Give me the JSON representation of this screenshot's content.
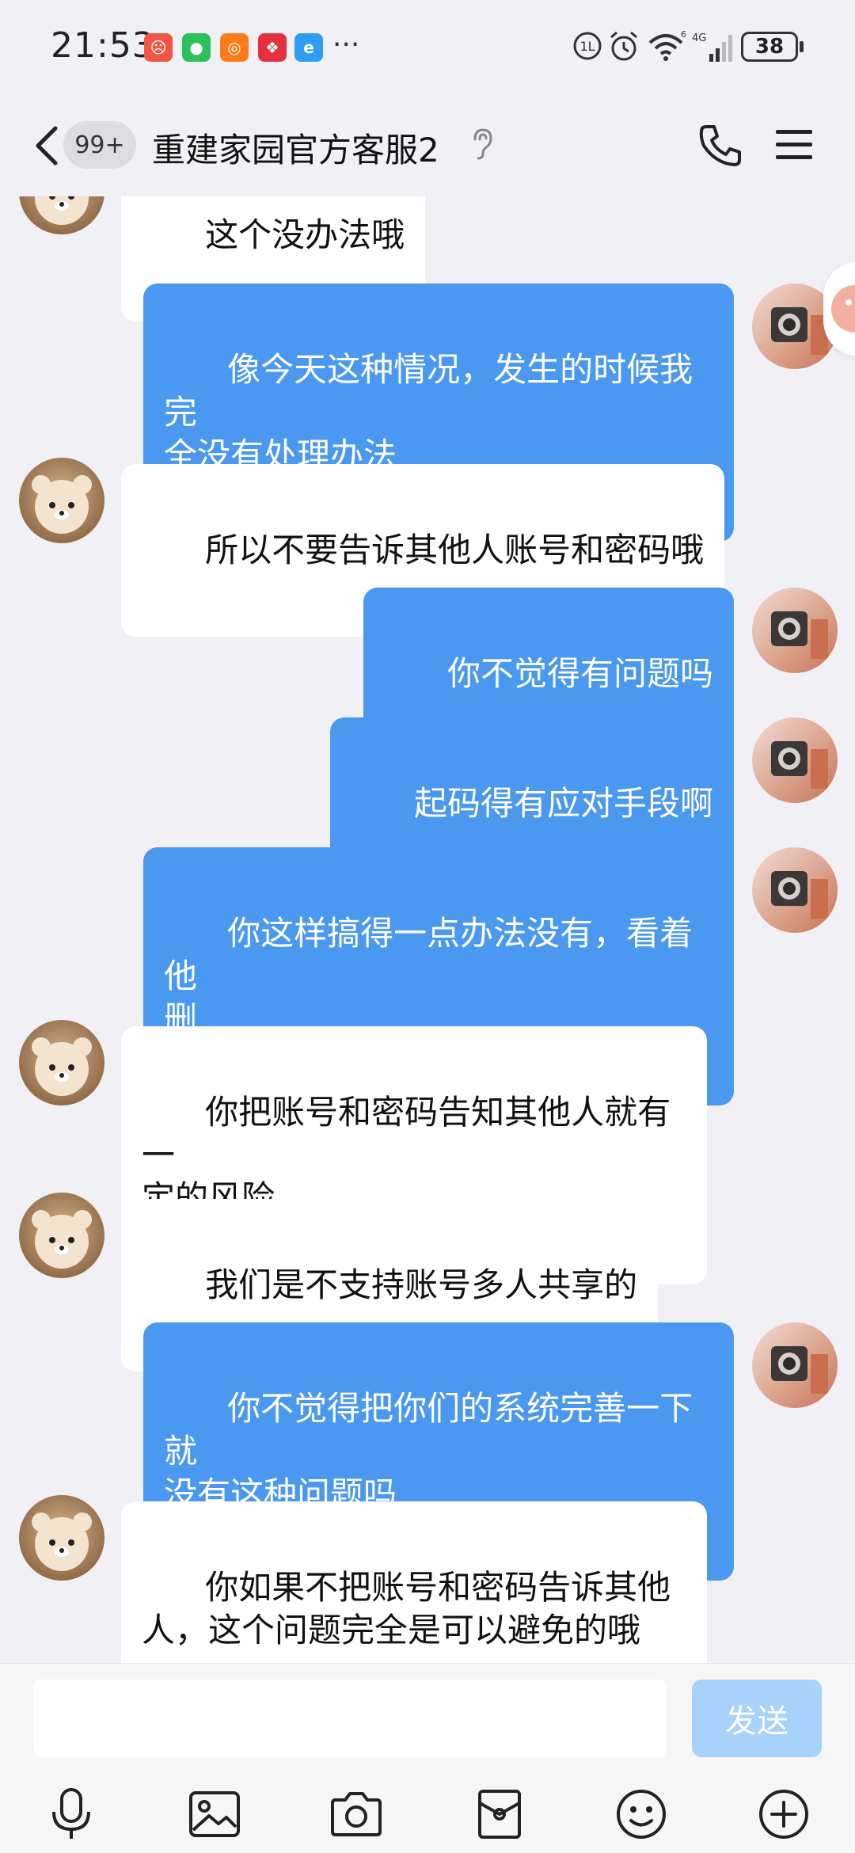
{
  "status_bar": {
    "time": "21:53",
    "battery": "38",
    "network": "4G",
    "signal_label": "6"
  },
  "header": {
    "unread_count": "99+",
    "title": "重建家园官方客服2"
  },
  "messages": [
    {
      "side": "in",
      "text": "这个没办法哦"
    },
    {
      "side": "out",
      "text": "像今天这种情况，发生的时候我完\n全没有处理办法"
    },
    {
      "side": "in",
      "text": "所以不要告诉其他人账号和密码哦"
    },
    {
      "side": "out",
      "text": "你不觉得有问题吗"
    },
    {
      "side": "out",
      "text": "起码得有应对手段啊"
    },
    {
      "side": "out",
      "text": "你这样搞得一点办法没有，看着他\n删"
    },
    {
      "side": "in",
      "text": "你把账号和密码告知其他人就有一\n定的风险"
    },
    {
      "side": "in",
      "text": "我们是不支持账号多人共享的"
    },
    {
      "side": "out",
      "text": "你不觉得把你们的系统完善一下就\n没有这种问题吗"
    },
    {
      "side": "in",
      "text": "你如果不把账号和密码告诉其他\n人，这个问题完全是可以避免的哦"
    }
  ],
  "input_bar": {
    "input_value": "",
    "send_label": "发送",
    "tools": [
      "mic-icon",
      "image-icon",
      "camera-icon",
      "red-packet-icon",
      "emoji-icon",
      "plus-icon"
    ]
  },
  "colors": {
    "outgoing_bubble": "#4a98ef",
    "incoming_bubble": "#ffffff",
    "background": "#f0f0f5",
    "send_button": "#a8d2fa"
  }
}
